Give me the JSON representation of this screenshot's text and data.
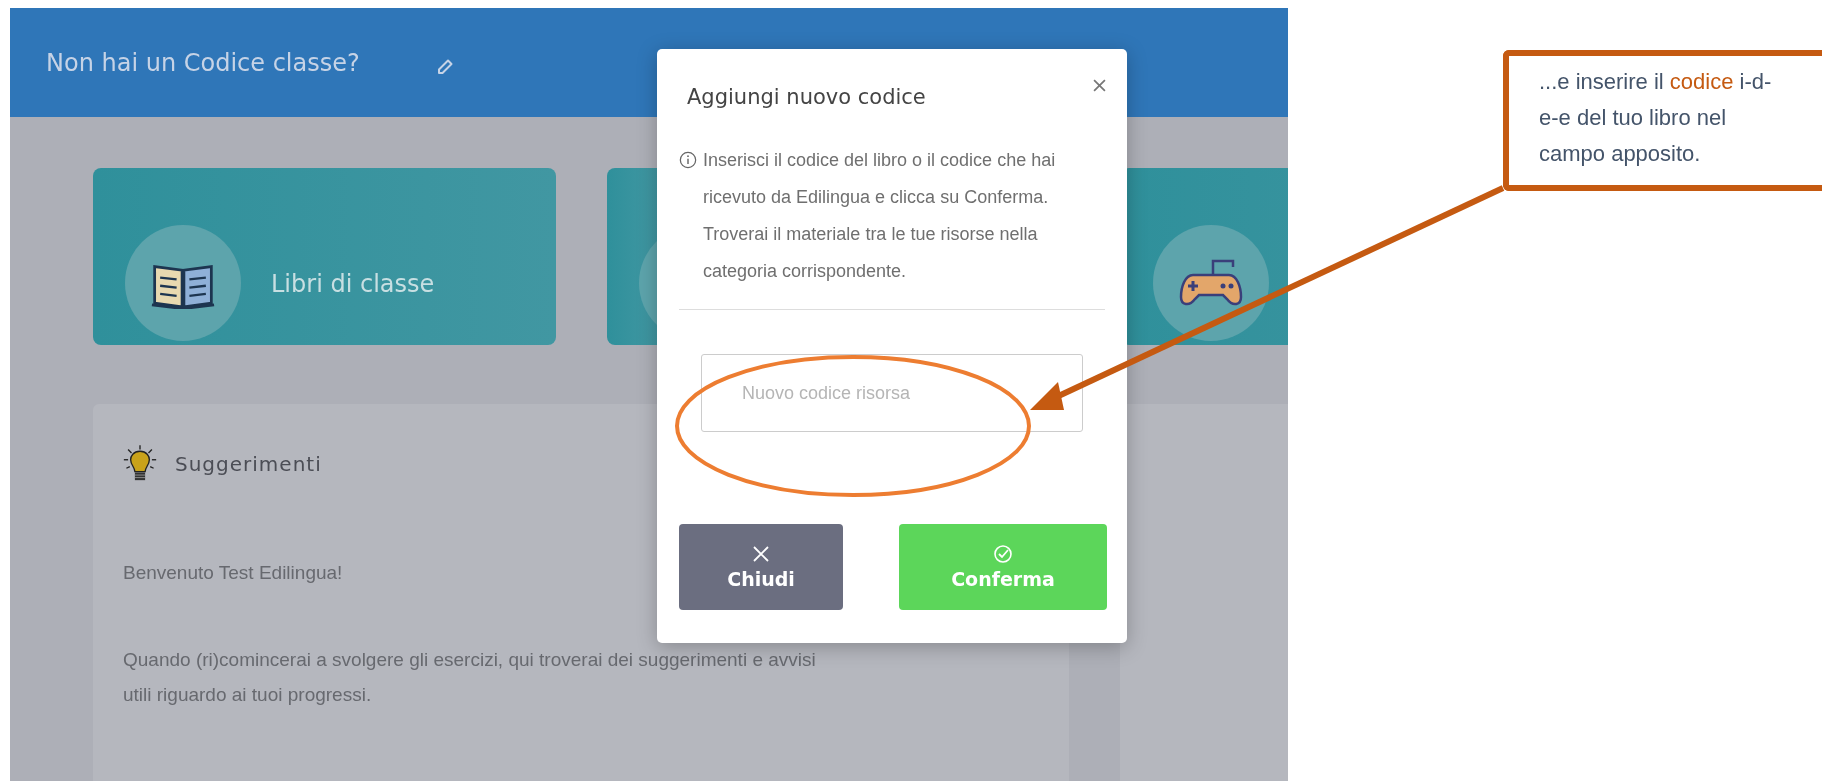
{
  "app": {
    "header": {
      "title": "Non hai un Codice classe?"
    },
    "tiles": [
      {
        "kind": "book",
        "label": "Libri di classe"
      },
      {
        "kind": "blank"
      },
      {
        "kind": "gamepad"
      }
    ],
    "suggestions": {
      "title": "Suggerimenti",
      "paragraphs": [
        "Benvenuto Test Edilingua!",
        "Quando (ri)comincerai a svolgere gli esercizi, qui troverai dei suggerimenti e avvisi utili riguardo ai tuoi progressi."
      ]
    }
  },
  "modal": {
    "title": "Aggiungi nuovo codice",
    "info": "Inserisci il codice del libro o il codice che hai ricevuto da Edilingua e clicca su Conferma. Troverai il materiale tra le tue risorse nella categoria corrispondente.",
    "field": {
      "placeholder": "Nuovo codice risorsa"
    },
    "buttons": [
      {
        "kind": "close",
        "label": "Chiudi"
      },
      {
        "kind": "confirm",
        "label": "Conferma"
      }
    ]
  },
  "callout": {
    "text": "...e inserire il **codice** i-d-e-e del tuo libro nel campo apposito."
  }
}
